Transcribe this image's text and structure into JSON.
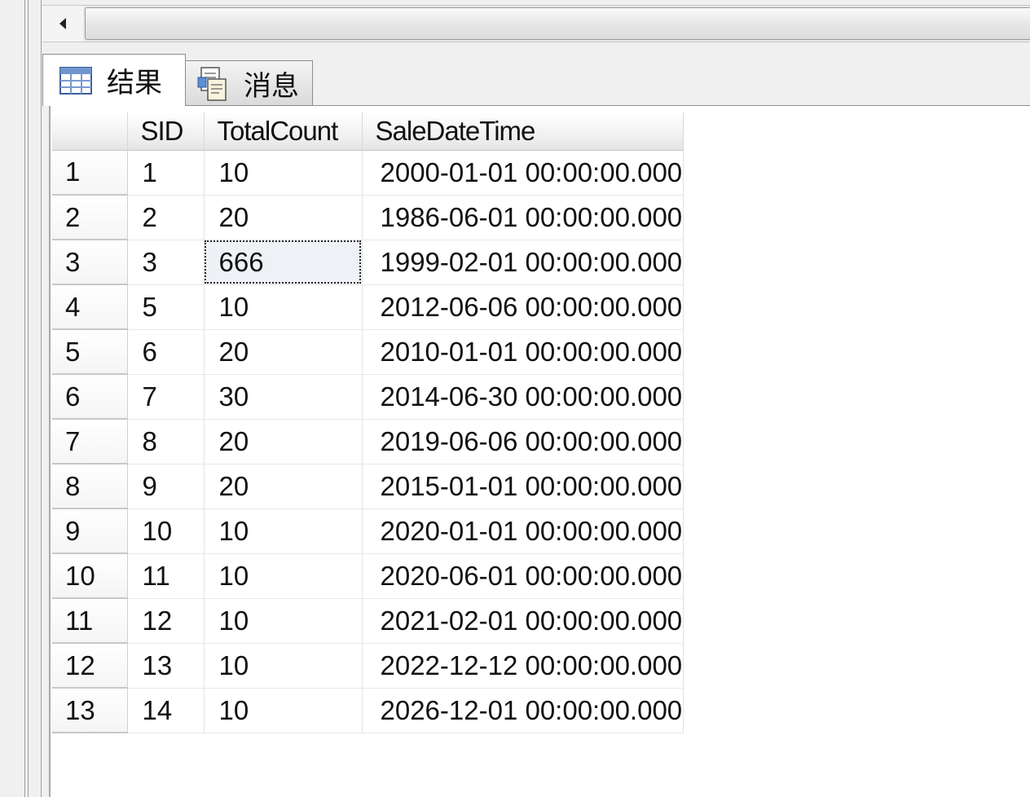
{
  "scrollbar": {
    "left_arrow_icon": "triangle-left-icon"
  },
  "tabs": [
    {
      "label": "结果",
      "icon": "grid-table-icon",
      "active": true
    },
    {
      "label": "消息",
      "icon": "message-document-icon",
      "active": false
    }
  ],
  "grid": {
    "columns": [
      "",
      "SID",
      "TotalCount",
      "SaleDateTime"
    ],
    "rows": [
      {
        "row": "1",
        "sid": "1",
        "total": "10",
        "date": "2000-01-01 00:00:00.000"
      },
      {
        "row": "2",
        "sid": "2",
        "total": "20",
        "date": "1986-06-01 00:00:00.000"
      },
      {
        "row": "3",
        "sid": "3",
        "total": "666",
        "date": "1999-02-01 00:00:00.000"
      },
      {
        "row": "4",
        "sid": "5",
        "total": "10",
        "date": "2012-06-06 00:00:00.000"
      },
      {
        "row": "5",
        "sid": "6",
        "total": "20",
        "date": "2010-01-01 00:00:00.000"
      },
      {
        "row": "6",
        "sid": "7",
        "total": "30",
        "date": "2014-06-30 00:00:00.000"
      },
      {
        "row": "7",
        "sid": "8",
        "total": "20",
        "date": "2019-06-06 00:00:00.000"
      },
      {
        "row": "8",
        "sid": "9",
        "total": "20",
        "date": "2015-01-01 00:00:00.000"
      },
      {
        "row": "9",
        "sid": "10",
        "total": "10",
        "date": "2020-01-01 00:00:00.000"
      },
      {
        "row": "10",
        "sid": "11",
        "total": "10",
        "date": "2020-06-01 00:00:00.000"
      },
      {
        "row": "11",
        "sid": "12",
        "total": "10",
        "date": "2021-02-01 00:00:00.000"
      },
      {
        "row": "12",
        "sid": "13",
        "total": "10",
        "date": "2022-12-12 00:00:00.000"
      },
      {
        "row": "13",
        "sid": "14",
        "total": "10",
        "date": "2026-12-01 00:00:00.000"
      }
    ],
    "selected_cell": {
      "row": 3,
      "column": "TotalCount"
    }
  },
  "colors": {
    "selected_cell_bg": "#eef1f5",
    "grid_bg": "#ffffff",
    "chrome_bg": "#f0f0f0"
  }
}
